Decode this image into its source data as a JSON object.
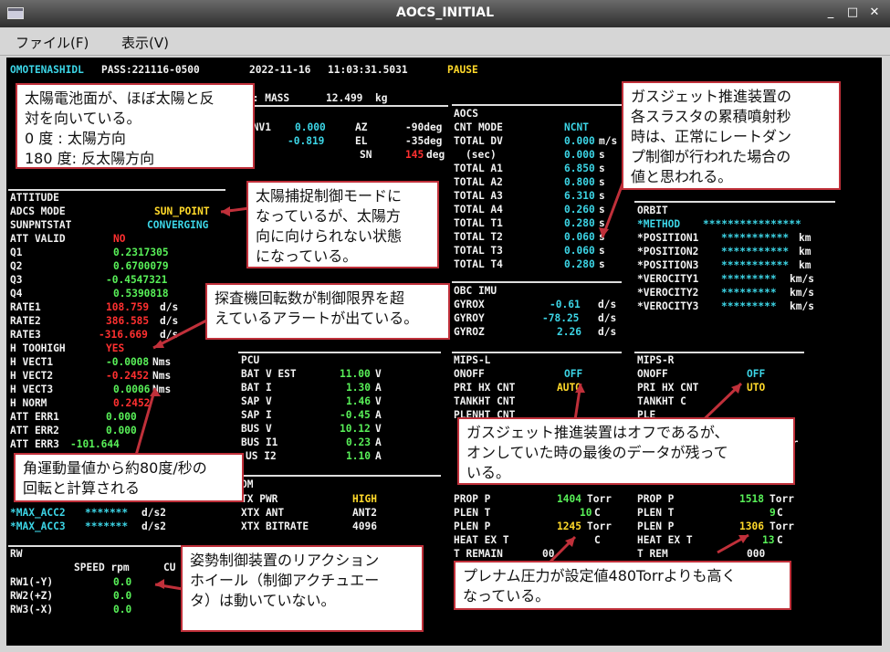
{
  "window": {
    "title": "AOCS_INITIAL"
  },
  "menu": {
    "file": "ファイル(F)",
    "view": "表示(V)"
  },
  "header": {
    "ship": "OMOTENASHIDL",
    "pass_label": "PASS:221116-0500",
    "date": "2022-11-16",
    "time": "11:03:31.5031",
    "state": "PAUSE"
  },
  "mass": {
    "label": "S: MASS",
    "value": "12.499",
    "unit": "kg"
  },
  "sun": {
    "head": "S",
    "r1a": "INV1",
    "r1b": "0.000",
    "r1c": "AZ",
    "r1d": "-90deg",
    "r2b": "-0.819",
    "r2c": "EL",
    "r2d": "-35deg",
    "r3c": "SN",
    "r3d": "145",
    "r3e": "deg"
  },
  "attitude": {
    "title": "ATTITUDE",
    "mode_label": "ADCS MODE",
    "mode": "SUN_POINT",
    "sps_label": "SUNPNTSTAT",
    "sps": "CONVERGING",
    "valid_label": "ATT VALID",
    "valid": "NO",
    "q1l": "Q1",
    "q1": "0.2317305",
    "q2l": "Q2",
    "q2": "0.6700079",
    "q3l": "Q3",
    "q3": "-0.4547321",
    "q4l": "Q4",
    "q4": "0.5390818",
    "rate1l": "RATE1",
    "rate1": "108.759",
    "rate2l": "RATE2",
    "rate2": "386.585",
    "rate3l": "RATE3",
    "rate3": "-316.669",
    "rateu": "d/s",
    "hthl": "H TOOHIGH",
    "hth": "YES",
    "hv1l": "H VECT1",
    "hv1": "-0.0008",
    "hv2l": "H VECT2",
    "hv2": "-0.2452",
    "hv3l": "H VECT3",
    "hv3": "0.0006",
    "hnl": "H NORM",
    "hn": "0.2452",
    "hu": "Nms",
    "ae1l": "ATT ERR1",
    "ae1": "0.000",
    "ae2l": "ATT ERR2",
    "ae2": "0.000",
    "ae3l": "ATT ERR3",
    "ae3": "-101.644",
    "ma2l": "*MAX_ACC2",
    "ma2": "*******",
    "ma3l": "*MAX_ACC3",
    "ma3": "*******",
    "mau": "d/s2"
  },
  "rw": {
    "title": "RW",
    "speed_head": "SPEED rpm",
    "cur_head": "CU",
    "r1l": "RW1(-Y)",
    "r1": "0.0",
    "r2l": "RW2(+Z)",
    "r2": "0.0",
    "r3l": "RW3(-X)",
    "r3": "0.0"
  },
  "pcu": {
    "title": "PCU",
    "l1": "BAT V EST",
    "v1": "11.00",
    "u1": "V",
    "l2": "BAT I",
    "v2": "1.30",
    "u2": "A",
    "l3": "SAP V",
    "v3": "1.46",
    "u3": "V",
    "l4": "SAP I",
    "v4": "-0.45",
    "u4": "A",
    "l5": "BUS V",
    "v5": "10.12",
    "u5": "V",
    "l6": "BUS I1",
    "v6": "0.23",
    "u6": "A",
    "l7": "US I2",
    "v7": "1.10",
    "u7": "A"
  },
  "com": {
    "title": "OM",
    "l1": "TX PWR",
    "v1": "HIGH",
    "l2": "XTX ANT",
    "v2": "ANT2",
    "l3": "XTX BITRATE",
    "v3": "4096"
  },
  "aocs": {
    "title": "AOCS",
    "l1": "CNT MODE",
    "v1": "NCNT",
    "l2": "TOTAL DV",
    "v2": "0.000",
    "u2": "m/s",
    "l3": "(sec)",
    "v3": "0.000",
    "u3": "s",
    "rows": [
      {
        "l": "TOTAL A1",
        "v": "6.850",
        "u": "s"
      },
      {
        "l": "TOTAL A2",
        "v": "0.800",
        "u": "s"
      },
      {
        "l": "TOTAL A3",
        "v": "6.310",
        "u": "s"
      },
      {
        "l": "TOTAL A4",
        "v": "0.260",
        "u": "s"
      },
      {
        "l": "TOTAL T1",
        "v": "0.280",
        "u": "s"
      },
      {
        "l": "TOTAL T2",
        "v": "0.060",
        "u": "s"
      },
      {
        "l": "TOTAL T3",
        "v": "0.060",
        "u": "s"
      },
      {
        "l": "TOTAL T4",
        "v": "0.280",
        "u": "s"
      }
    ]
  },
  "imu": {
    "title": "OBC IMU",
    "l1": "GYROX",
    "v1": "-0.61",
    "l2": "GYROY",
    "v2": "-78.25",
    "l3": "GYROZ",
    "v3": "2.26",
    "u": "d/s"
  },
  "orbit": {
    "title": "ORBIT",
    "ml": "*METHOD",
    "mv": "****************",
    "p1l": "*POSITION1",
    "p2l": "*POSITION2",
    "p3l": "*POSITION3",
    "pv": "***********",
    "pu": "km",
    "v1l": "*VEROCITY1",
    "v2l": "*VEROCITY2",
    "v3l": "*VEROCITY3",
    "vv": "*********",
    "vu": "km/s"
  },
  "mipsl": {
    "title": "MIPS-L",
    "l1": "ONOFF",
    "v1": "OFF",
    "l2": "PRI HX CNT",
    "v2": "AUTO",
    "l3": "TANKHT CNT",
    "l4": "PLENHT CNT",
    "pl": "PROP P",
    "pv": "1404",
    "pu": "Torr",
    "tl": "PLEN T",
    "tv": "10",
    "tu": "C",
    "ppl": "PLEN P",
    "ppv": "1245",
    "ppu": "Torr",
    "hl": "HEAT EX T",
    "hv": "C",
    "rl": "T REMAIN",
    "rv": "00"
  },
  "mipsr": {
    "title": "MIPS-R",
    "l1": "ONOFF",
    "v1": "OFF",
    "l2": "PRI HX CNT",
    "v2": "UTO",
    "l3": "TANKHT C",
    "l4": "PLE",
    "pl": "PROP P",
    "pv": "1518",
    "pu": "Torr",
    "tl": "PLEN T",
    "tv": "9",
    "tu": "C",
    "ppl": "PLEN P",
    "ppv": "1306",
    "ppu": "Torr",
    "hl": "HEAT EX T",
    "hv": "13",
    "hu": "C",
    "rl": "T REM",
    "rv": "000",
    "xr": "rr"
  },
  "callouts": {
    "c1": "太陽電池面が、ほぼ太陽と反\n対を向いている。\n0 度 : 太陽方向\n180 度: 反太陽方向",
    "c2": "太陽捕捉制御モードに\nなっているが、太陽方\n向に向けられない状態\nになっている。",
    "c3": "探査機回転数が制御限界を超\nえているアラートが出ている。",
    "c4": "角運動量値から約80度/秒の\n回転と計算される",
    "c5": "姿勢制御装置のリアクション\nホイール（制御アクチュエー\nタ）は動いていない。",
    "c6": "ガスジェット推進装置の\n各スラスタの累積噴射秒\n時は、正常にレートダン\nプ制御が行われた場合の\n値と思われる。",
    "c7": "ガスジェット推進装置はオフであるが、\nオンしていた時の最後のデータが残って\nいる。",
    "c8": "プレナム圧力が設定値480Torrよりも高く\nなっている。"
  }
}
